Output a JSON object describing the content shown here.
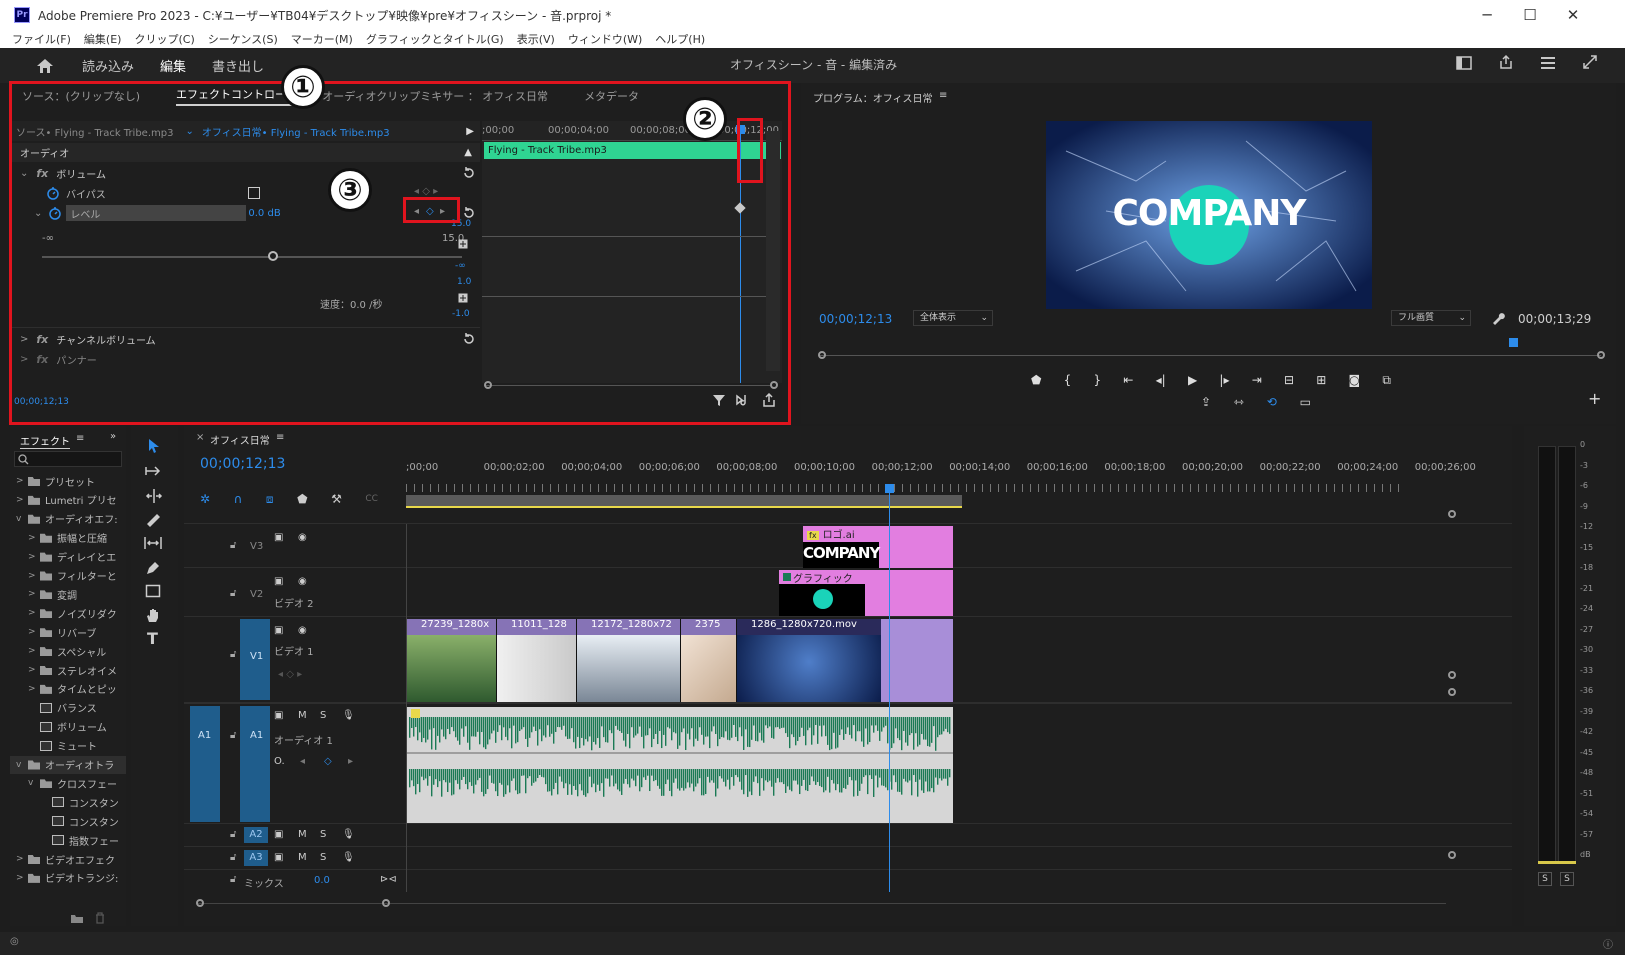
{
  "window": {
    "title": "Adobe Premiere Pro 2023 - C:¥ユーザー¥TB04¥デスクトップ¥映像¥pre¥オフィスシーン - 音.prproj *",
    "logo": "Pr",
    "minimize": "─",
    "maximize": "☐",
    "close": "✕"
  },
  "menu": [
    "ファイル(F)",
    "編集(E)",
    "クリップ(C)",
    "シーケンス(S)",
    "マーカー(M)",
    "グラフィックとタイトル(G)",
    "表示(V)",
    "ウィンドウ(W)",
    "ヘルプ(H)"
  ],
  "workspace": {
    "tabs": [
      "読み込み",
      "編集",
      "書き出し"
    ],
    "active": "編集",
    "center_title": "オフィスシーン - 音 - 編集済み"
  },
  "source_panel": {
    "tabs": [
      "ソース：(クリップなし)",
      "エフェクトコントロール",
      "オーディオクリップミキサー ： オフィス日常",
      "メタデータ"
    ],
    "menu_icon": "≡",
    "source_label": "ソース• Flying - Track Tribe.mp3",
    "sequence_label": "オフィス日常• Flying - Track Tribe.mp3",
    "ruler_labels": [
      ";00;00",
      "00;00;04;00",
      "00;00;08;00",
      "00;00;12;00"
    ],
    "clip_name": "Flying - Track Tribe.mp3",
    "section_audio": "オーディオ",
    "effect_volume": "ボリューム",
    "bypass": "バイパス",
    "level_label": "レベル",
    "level_value": "0.0 dB",
    "slider_min": "-∞",
    "slider_max": "15.0",
    "value_graph_top": "15.0",
    "value_graph_bottom": "-∞",
    "velocity_top": "1.0",
    "velocity_bottom": "-1.0",
    "velocity_label": "速度：0.0 /秒",
    "channel_volume": "チャンネルボリューム",
    "panner": "パンナー",
    "timecode": "00;00;12;13",
    "fx_symbol": "fx"
  },
  "annotations": {
    "one": "①",
    "two": "②",
    "three": "③"
  },
  "program_monitor": {
    "title": "プログラム：オフィス日常",
    "menu_icon": "≡",
    "timecode": "00;00;12;13",
    "fit": "全体表示",
    "quality": "フル画質",
    "duration": "00;00;13;29",
    "company_text": "COMPANY",
    "plus": "+"
  },
  "effects_panel": {
    "title": "エフェクト",
    "menu_icon": "≡",
    "expand_icon": "»",
    "items": [
      {
        "label": "プリセット",
        "indent": 0,
        "type": "folder",
        "arrow": ">"
      },
      {
        "label": "Lumetri プリセ",
        "indent": 0,
        "type": "folder",
        "arrow": ">"
      },
      {
        "label": "オーディオエフ:",
        "indent": 0,
        "type": "folder",
        "arrow": "v"
      },
      {
        "label": "振幅と圧縮",
        "indent": 1,
        "type": "folder",
        "arrow": ">"
      },
      {
        "label": "ディレイとエ",
        "indent": 1,
        "type": "folder",
        "arrow": ">"
      },
      {
        "label": "フィルターと",
        "indent": 1,
        "type": "folder",
        "arrow": ">"
      },
      {
        "label": "変調",
        "indent": 1,
        "type": "folder",
        "arrow": ">"
      },
      {
        "label": "ノイズリダク",
        "indent": 1,
        "type": "folder",
        "arrow": ">"
      },
      {
        "label": "リバーブ",
        "indent": 1,
        "type": "folder",
        "arrow": ">"
      },
      {
        "label": "スペシャル",
        "indent": 1,
        "type": "folder",
        "arrow": ">"
      },
      {
        "label": "ステレオイメ",
        "indent": 1,
        "type": "folder",
        "arrow": ">"
      },
      {
        "label": "タイムとピッ",
        "indent": 1,
        "type": "folder",
        "arrow": ">"
      },
      {
        "label": "バランス",
        "indent": 1,
        "type": "fx",
        "arrow": ""
      },
      {
        "label": "ボリューム",
        "indent": 1,
        "type": "fx",
        "arrow": ""
      },
      {
        "label": "ミュート",
        "indent": 1,
        "type": "fx",
        "arrow": ""
      },
      {
        "label": "オーディオトラ",
        "indent": 0,
        "type": "folder",
        "arrow": "v"
      },
      {
        "label": "クロスフェー",
        "indent": 1,
        "type": "folder",
        "arrow": "v"
      },
      {
        "label": "コンスタン",
        "indent": 2,
        "type": "fx",
        "arrow": ""
      },
      {
        "label": "コンスタン",
        "indent": 2,
        "type": "fx",
        "arrow": ""
      },
      {
        "label": "指数フェー",
        "indent": 2,
        "type": "fx",
        "arrow": ""
      },
      {
        "label": "ビデオエフェク",
        "indent": 0,
        "type": "folder",
        "arrow": ">"
      },
      {
        "label": "ビデオトランジ:",
        "indent": 0,
        "type": "folder",
        "arrow": ">"
      }
    ]
  },
  "timeline": {
    "close": "×",
    "sequence": "オフィス日常",
    "menu_icon": "≡",
    "timecode": "00;00;12;13",
    "ruler": [
      ";00;00",
      "00;00;02;00",
      "00;00;04;00",
      "00;00;06;00",
      "00;00;08;00",
      "00;00;10;00",
      "00;00;12;00",
      "00;00;14;00",
      "00;00;16;00",
      "00;00;18;00",
      "00;00;20;00",
      "00;00;22;00",
      "00;00;24;00",
      "00;00;26;00"
    ],
    "tracks": {
      "v3": "V3",
      "v2": "V2",
      "v2_name": "ビデオ 2",
      "v1": "V1",
      "v1_name": "ビデオ 1",
      "a1": "A1",
      "a1_name": "オーディオ 1",
      "a2": "A2",
      "a3": "A3",
      "mix": "ミックス",
      "mix_value": "0.0",
      "m": "M",
      "s": "S"
    },
    "clips": {
      "logo": "ロゴ.ai",
      "graphic": "グラフィック",
      "v1": [
        "27239_1280x",
        "11011_128",
        "12172_1280x72",
        "2375",
        "1286_1280x720.mov"
      ],
      "logo_fx": "fx",
      "logo_text": "COMPANY"
    }
  },
  "meter": {
    "labels": [
      "0",
      "-3",
      "-6",
      "-9",
      "-12",
      "-15",
      "-18",
      "-21",
      "-24",
      "-27",
      "-30",
      "-33",
      "-36",
      "-39",
      "-42",
      "-45",
      "-48",
      "-51",
      "-54",
      "-57",
      "dB"
    ],
    "solo": [
      "S",
      "S"
    ]
  },
  "colors": {
    "accent": "#2d8ceb",
    "red_annotation": "#e0141e",
    "audio_clip_green": "#2fd492",
    "graphic_pink": "#e27ee0",
    "video_purple": "#a88ed8",
    "waveform": "#1b7a55"
  }
}
